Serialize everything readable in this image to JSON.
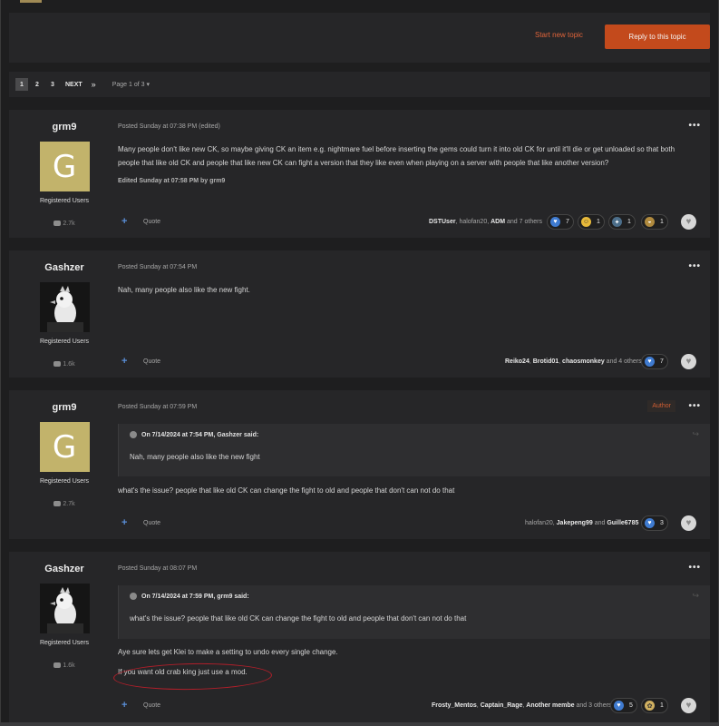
{
  "topbar": {
    "start_new_topic": "Start new topic",
    "reply_to_topic": "Reply to this topic"
  },
  "pagination": {
    "pages": [
      "1",
      "2",
      "3"
    ],
    "next": "NEXT",
    "last": "»",
    "page_of": "Page 1 of 3 ▾"
  },
  "posts": [
    {
      "author": "grm9",
      "avatar_letter": "G",
      "role": "Registered Users",
      "post_count": "2.7k",
      "meta": "Posted Sunday at 07:38 PM (edited)",
      "body": "Many people don't like new CK, so maybe giving CK an item e.g. nightmare fuel before inserting the gems could turn it into old CK for until it'll die or get unloaded so that both people that like old CK and people that like new CK can fight a version that they like even when playing on a server with people that like another version?",
      "edited": "Edited Sunday at 07:58 PM by grm9",
      "quote_label": "Quote",
      "reactors": [
        "DSTUser",
        "halofan20",
        "ADM"
      ],
      "reactors_sep1": ", ",
      "reactors_sep2": ", ",
      "reactors_and": " and 7 others",
      "reactions": [
        {
          "icon": "like-icon",
          "count": "7"
        },
        {
          "icon": "haha-icon",
          "count": "1"
        },
        {
          "icon": "thumbs-icon",
          "count": "1"
        },
        {
          "icon": "bowl-icon",
          "count": "1"
        }
      ]
    },
    {
      "author": "Gashzer",
      "role": "Registered Users",
      "post_count": "1.6k",
      "meta": "Posted Sunday at 07:54 PM",
      "body": "Nah, many people also like the new fight.",
      "quote_label": "Quote",
      "reactors": [
        "Reiko24",
        "Brotid01",
        "chaosmonkey"
      ],
      "reactors_and": " and 4 others",
      "reactions": [
        {
          "icon": "like-icon",
          "count": "7"
        }
      ]
    },
    {
      "author": "grm9",
      "avatar_letter": "G",
      "role": "Registered Users",
      "post_count": "2.7k",
      "meta": "Posted Sunday at 07:59 PM",
      "author_tag": "Author",
      "quote_head": "On 7/14/2024 at 7:54 PM, Gashzer said:",
      "quote_text": "Nah, many people also like the new fight",
      "body": "what's the issue? people that like old CK can change the fight to old and people that don't can not do that",
      "quote_label": "Quote",
      "reactors": [
        "halofan20",
        "Jakepeng99",
        "Guille6785"
      ],
      "reactors_and_word": " and ",
      "reactions": [
        {
          "icon": "like-icon",
          "count": "3"
        }
      ]
    },
    {
      "author": "Gashzer",
      "role": "Registered Users",
      "post_count": "1.6k",
      "meta": "Posted Sunday at 08:07 PM",
      "quote_head": "On 7/14/2024 at 7:59 PM, grm9 said:",
      "quote_text": "what's the issue? people that like old CK can change the fight to old and people that don't can not do that",
      "body_line1": "Aye sure lets get Klei to make a setting to undo every single change.",
      "body_line2": "If you want old crab king just use a mod.",
      "quote_label": "Quote",
      "reactors": [
        "Frosty_Mentos",
        "Captain_Rage",
        "Another membe"
      ],
      "reactors_and": " and 3 others",
      "reactions": [
        {
          "icon": "like-icon",
          "count": "5"
        },
        {
          "icon": "crab-icon",
          "count": "1"
        }
      ]
    }
  ],
  "colors": {
    "accent": "#c34a1c",
    "link": "#e0643a",
    "annotation": "#b11f2a"
  }
}
